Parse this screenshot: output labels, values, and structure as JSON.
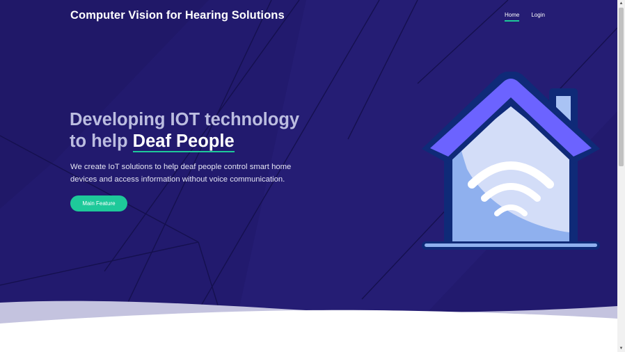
{
  "header": {
    "brand": "Computer Vision for Hearing Solutions",
    "nav": [
      {
        "label": "Home",
        "active": true
      },
      {
        "label": "Login",
        "active": false
      }
    ]
  },
  "hero": {
    "headline_line1": "Developing IOT technology",
    "headline_line2_prefix": "to help",
    "headline_line2_accent": "Deaf People",
    "description": "We create IoT solutions to help deaf people control smart home devices and access information without voice communication.",
    "cta_label": "Main Feature",
    "illustration_icon": "smart-home-wifi-icon"
  },
  "colors": {
    "hero_background": "#221a6e",
    "accent": "#1ec99a",
    "roof": "#6c63ff",
    "house_outline": "#0f2a78",
    "house_body": "#8fb0ee"
  }
}
